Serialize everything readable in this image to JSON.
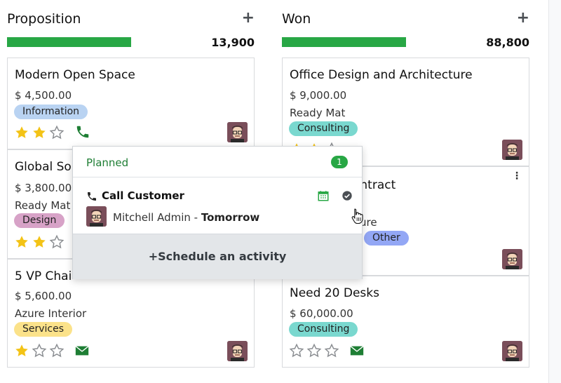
{
  "colors": {
    "progress": "#28a745",
    "star_on": "#f3c316",
    "star_off": "#8a8d91",
    "phone": "#1e7e34",
    "mail": "#1e7e34",
    "tag_information": "#b9d3f2",
    "tag_design": "#d7a2c7",
    "tag_services": "#fbe28a",
    "tag_consulting": "#7ad8cf",
    "tag_other": "#93a7f5"
  },
  "columns": [
    {
      "title": "Proposition",
      "total": "13,900",
      "progress": 0.5,
      "cards": [
        {
          "title": "Modern Open Space",
          "amount": "$ 4,500.00",
          "company": "",
          "tag": "Information",
          "rating": 2,
          "activity": "phone-icon"
        },
        {
          "title": "Global Sol",
          "amount": "$ 3,800.00",
          "company": "Ready Mat",
          "tag": "Design",
          "rating": 2,
          "activity": ""
        },
        {
          "title": "5 VP Chai",
          "amount": "$ 5,600.00",
          "company": "Azure Interior",
          "tag": "Services",
          "rating": 1,
          "activity": "envelope-icon"
        }
      ]
    },
    {
      "title": "Won",
      "total": "88,800",
      "progress": 0.5,
      "cards": [
        {
          "title": "Office Design and Architecture",
          "amount": "$ 9,000.00",
          "company": "Ready Mat",
          "tag": "Consulting",
          "rating": 2,
          "activity": ""
        },
        {
          "title": "ontract",
          "amount": "",
          "company": "ure",
          "tag": "Other",
          "rating": 0,
          "activity": ""
        },
        {
          "title": "Need 20 Desks",
          "amount": "$ 60,000.00",
          "company": "",
          "tag": "Consulting",
          "rating": 0,
          "activity": "envelope-icon"
        }
      ]
    }
  ],
  "popover": {
    "status": "Planned",
    "count": "1",
    "activity_title": "Call Customer",
    "user": "Mitchell Admin",
    "separator": " - ",
    "when": "Tomorrow",
    "schedule_label": "Schedule an activity",
    "schedule_icon": "+"
  },
  "icons": {
    "add": "+",
    "kebab": "⋮"
  }
}
